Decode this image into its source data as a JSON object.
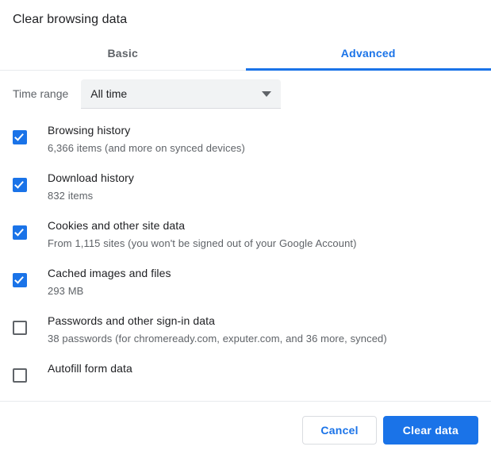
{
  "dialog": {
    "title": "Clear browsing data"
  },
  "tabs": [
    {
      "label": "Basic",
      "active": false
    },
    {
      "label": "Advanced",
      "active": true
    }
  ],
  "time_range": {
    "label": "Time range",
    "selected": "All time",
    "arrow_icon": "chevron-down-icon"
  },
  "items": [
    {
      "title": "Browsing history",
      "subtitle": "6,366 items (and more on synced devices)",
      "checked": true
    },
    {
      "title": "Download history",
      "subtitle": "832 items",
      "checked": true
    },
    {
      "title": "Cookies and other site data",
      "subtitle": "From 1,115 sites (you won't be signed out of your Google Account)",
      "checked": true
    },
    {
      "title": "Cached images and files",
      "subtitle": "293 MB",
      "checked": true
    },
    {
      "title": "Passwords and other sign-in data",
      "subtitle": "38 passwords (for chromeready.com, exputer.com, and 36 more, synced)",
      "checked": false
    },
    {
      "title": "Autofill form data",
      "subtitle": "",
      "checked": false
    }
  ],
  "footer": {
    "cancel_label": "Cancel",
    "confirm_label": "Clear data"
  },
  "colors": {
    "accent": "#1a73e8",
    "text_primary": "#202124",
    "text_secondary": "#5f6368",
    "divider": "#e8eaed",
    "select_bg": "#f1f3f4"
  }
}
